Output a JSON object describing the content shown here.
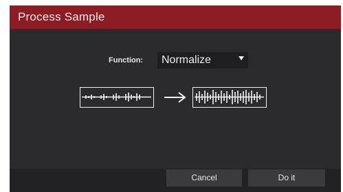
{
  "dialog": {
    "title": "Process Sample"
  },
  "function": {
    "label": "Function:",
    "selected": "Normalize"
  },
  "illustration": {
    "before_icon": "waveform-icon",
    "arrow_icon": "right-arrow-icon",
    "after_icon": "normalized-waveform-icon"
  },
  "buttons": {
    "cancel": "Cancel",
    "do_it": "Do it"
  },
  "colors": {
    "titlebar": "#8d1d24",
    "body": "#2b2b2d",
    "footer": "#222224",
    "button": "#3b3b3d"
  }
}
